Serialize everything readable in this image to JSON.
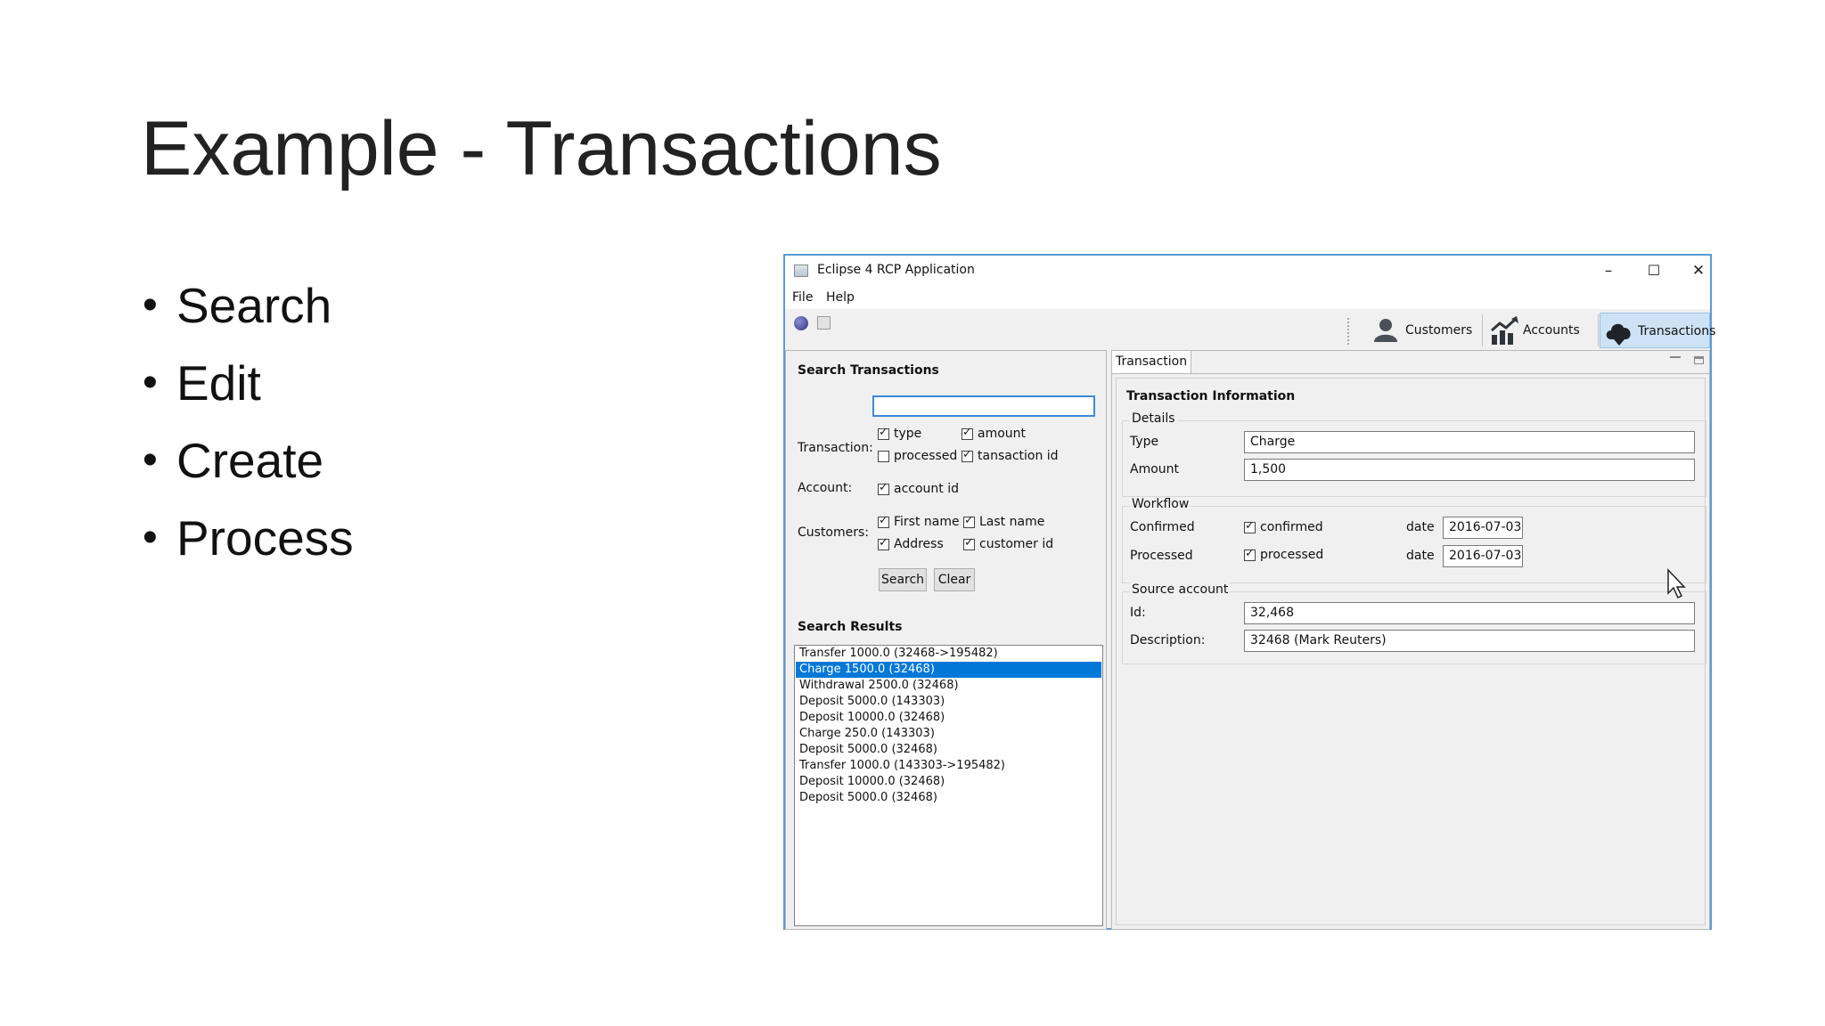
{
  "slide": {
    "title": "Example - Transactions",
    "bullets": [
      "Search",
      "Edit",
      "Create",
      "Process"
    ]
  },
  "window": {
    "title": "Eclipse 4 RCP Application",
    "controls": {
      "minimize": "–",
      "maximize": "☐",
      "close": "✕"
    },
    "menu": [
      "File",
      "Help"
    ],
    "toolbar": {
      "icons": [
        "globe-icon",
        "save-icon"
      ]
    },
    "perspectives": [
      {
        "label": "Customers",
        "icon": "customer-icon",
        "active": false
      },
      {
        "label": "Accounts",
        "icon": "chart-icon",
        "active": false
      },
      {
        "label": "Transactions",
        "icon": "cloud-icon",
        "active": true
      }
    ]
  },
  "search": {
    "heading": "Search Transactions",
    "query": "",
    "transaction_label": "Transaction:",
    "transaction_options": [
      {
        "label": "type",
        "checked": true
      },
      {
        "label": "amount",
        "checked": true
      },
      {
        "label": "processed",
        "checked": false
      },
      {
        "label": "tansaction id",
        "checked": true
      }
    ],
    "account_label": "Account:",
    "account_options": [
      {
        "label": "account id",
        "checked": true
      }
    ],
    "customers_label": "Customers:",
    "customer_options": [
      {
        "label": "First name",
        "checked": true
      },
      {
        "label": "Last name",
        "checked": true
      },
      {
        "label": "Address",
        "checked": true
      },
      {
        "label": "customer id",
        "checked": true
      }
    ],
    "search_button": "Search",
    "clear_button": "Clear",
    "results_heading": "Search Results",
    "results": [
      "Transfer 1000.0 (32468->195482)",
      "Charge 1500.0 (32468)",
      "Withdrawal 2500.0 (32468)",
      "Deposit 5000.0 (143303)",
      "Deposit 10000.0 (32468)",
      "Charge 250.0 (143303)",
      "Deposit 5000.0 (32468)",
      "Transfer 1000.0 (143303->195482)",
      "Deposit 10000.0 (32468)",
      "Deposit 5000.0 (32468)"
    ],
    "selected_index": 1
  },
  "editor": {
    "tab": "Transaction",
    "heading": "Transaction Information",
    "details": {
      "title": "Details",
      "type_label": "Type",
      "type_value": "Charge",
      "amount_label": "Amount",
      "amount_value": "1,500"
    },
    "workflow": {
      "title": "Workflow",
      "confirmed_label": "Confirmed",
      "confirmed_cb": "confirmed",
      "confirmed_checked": true,
      "confirmed_date_label": "date",
      "confirmed_date": "2016-07-03",
      "processed_label": "Processed",
      "processed_cb": "processed",
      "processed_checked": true,
      "processed_date_label": "date",
      "processed_date": "2016-07-03"
    },
    "source": {
      "title": "Source account",
      "id_label": "Id:",
      "id_value": "32,468",
      "desc_label": "Description:",
      "desc_value": "32468 (Mark Reuters)"
    }
  }
}
